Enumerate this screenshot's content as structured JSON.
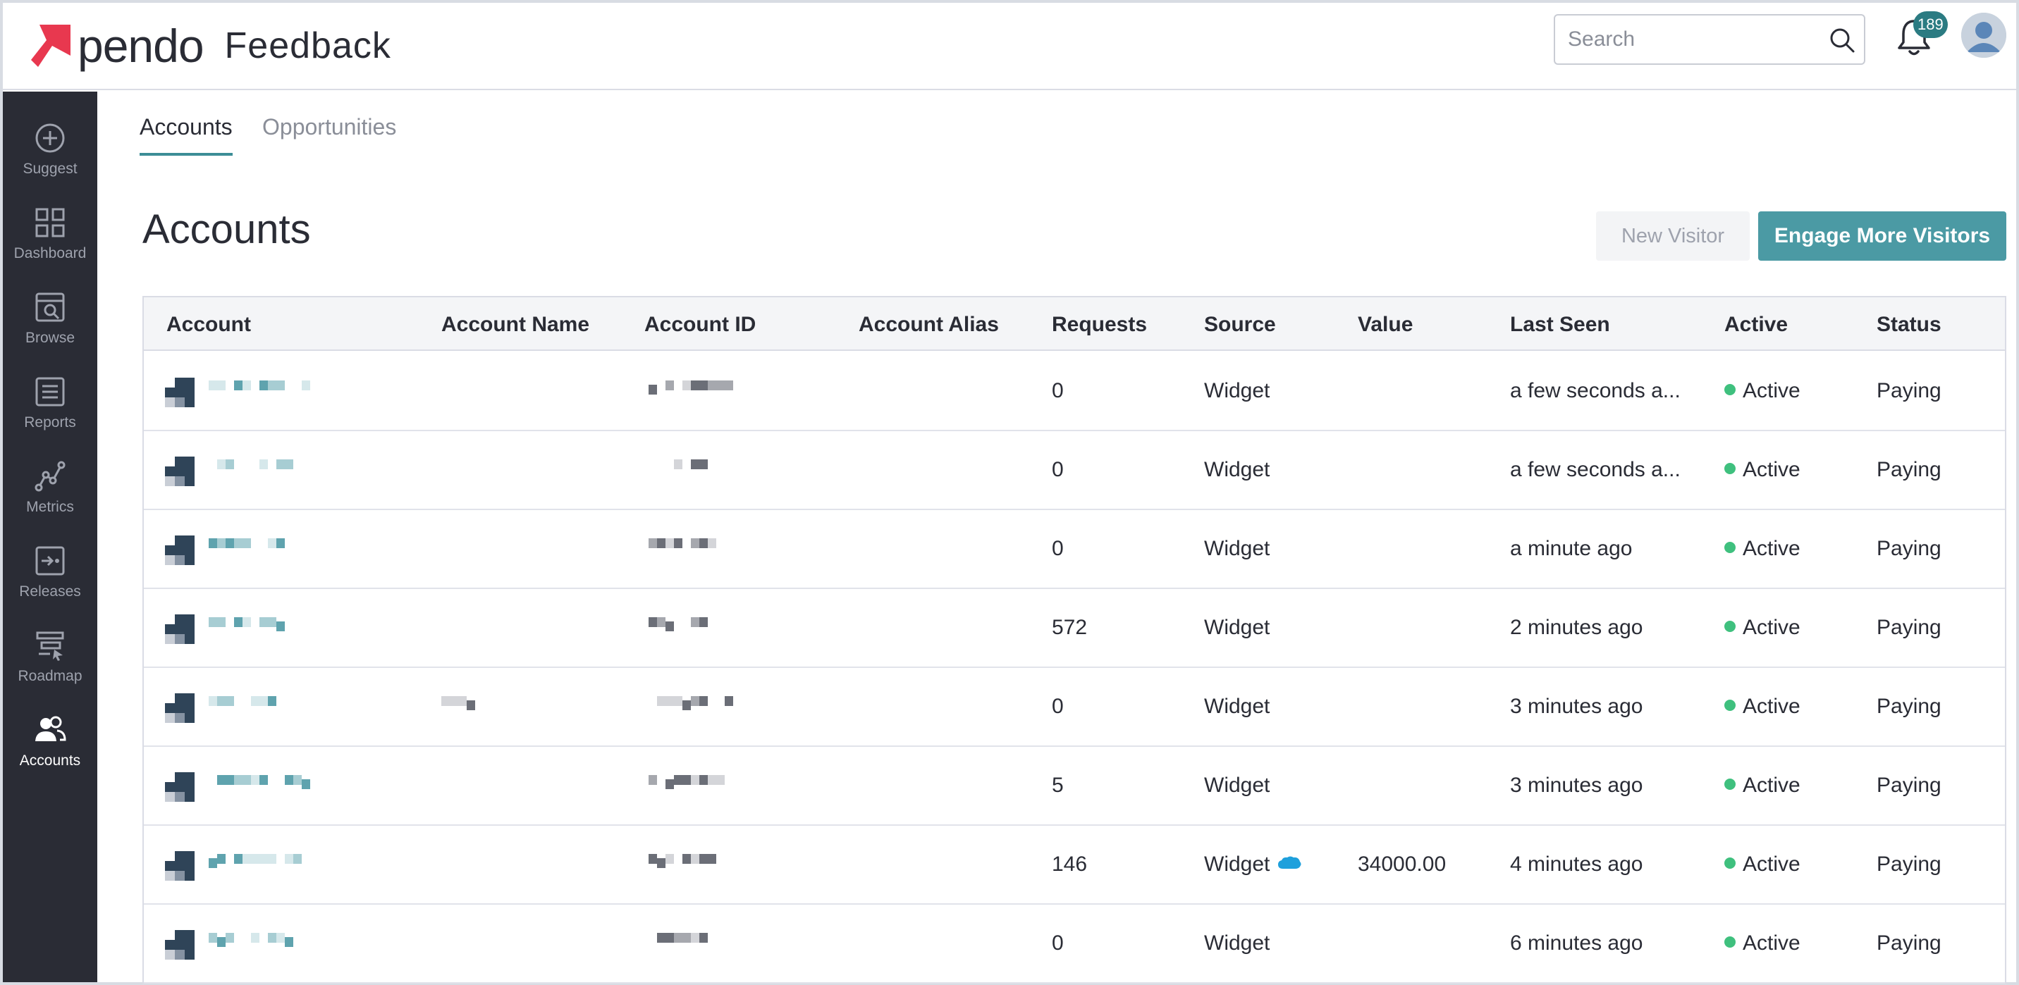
{
  "app": {
    "logo_text": "pendo",
    "product_name": "Feedback"
  },
  "header": {
    "search_placeholder": "Search",
    "notification_count": "189"
  },
  "sidebar": {
    "items": [
      {
        "label": "Suggest",
        "icon": "plus-circle-icon"
      },
      {
        "label": "Dashboard",
        "icon": "grid-icon"
      },
      {
        "label": "Browse",
        "icon": "browse-icon"
      },
      {
        "label": "Reports",
        "icon": "reports-icon"
      },
      {
        "label": "Metrics",
        "icon": "metrics-icon"
      },
      {
        "label": "Releases",
        "icon": "releases-icon"
      },
      {
        "label": "Roadmap",
        "icon": "roadmap-icon"
      },
      {
        "label": "Accounts",
        "icon": "users-icon",
        "active": true
      }
    ]
  },
  "tabs": [
    {
      "label": "Accounts",
      "active": true
    },
    {
      "label": "Opportunities",
      "active": false
    }
  ],
  "page": {
    "title": "Accounts",
    "new_visitor_label": "New Visitor",
    "engage_label": "Engage More Visitors"
  },
  "colors": {
    "sidebar_bg": "#2a2c35",
    "accent": "#4b9aa4",
    "active_dot": "#3fc07e",
    "badge": "#2b7b82"
  },
  "table": {
    "columns": [
      "Account",
      "Account Name",
      "Account ID",
      "Account Alias",
      "Requests",
      "Source",
      "Value",
      "Last Seen",
      "Active",
      "Status"
    ],
    "rows": [
      {
        "requests": "0",
        "source": "Widget",
        "value": "",
        "salesforce": false,
        "last_seen": "a few seconds a...",
        "active": "Active",
        "status": "Paying"
      },
      {
        "requests": "0",
        "source": "Widget",
        "value": "",
        "salesforce": false,
        "last_seen": "a few seconds a...",
        "active": "Active",
        "status": "Paying"
      },
      {
        "requests": "0",
        "source": "Widget",
        "value": "",
        "salesforce": false,
        "last_seen": "a minute ago",
        "active": "Active",
        "status": "Paying"
      },
      {
        "requests": "572",
        "source": "Widget",
        "value": "",
        "salesforce": false,
        "last_seen": "2 minutes ago",
        "active": "Active",
        "status": "Paying"
      },
      {
        "requests": "0",
        "source": "Widget",
        "value": "",
        "salesforce": false,
        "last_seen": "3 minutes ago",
        "active": "Active",
        "status": "Paying"
      },
      {
        "requests": "5",
        "source": "Widget",
        "value": "",
        "salesforce": false,
        "last_seen": "3 minutes ago",
        "active": "Active",
        "status": "Paying"
      },
      {
        "requests": "146",
        "source": "Widget",
        "value": "34000.00",
        "salesforce": true,
        "last_seen": "4 minutes ago",
        "active": "Active",
        "status": "Paying"
      },
      {
        "requests": "0",
        "source": "Widget",
        "value": "",
        "salesforce": false,
        "last_seen": "6 minutes ago",
        "active": "Active",
        "status": "Paying"
      }
    ]
  }
}
